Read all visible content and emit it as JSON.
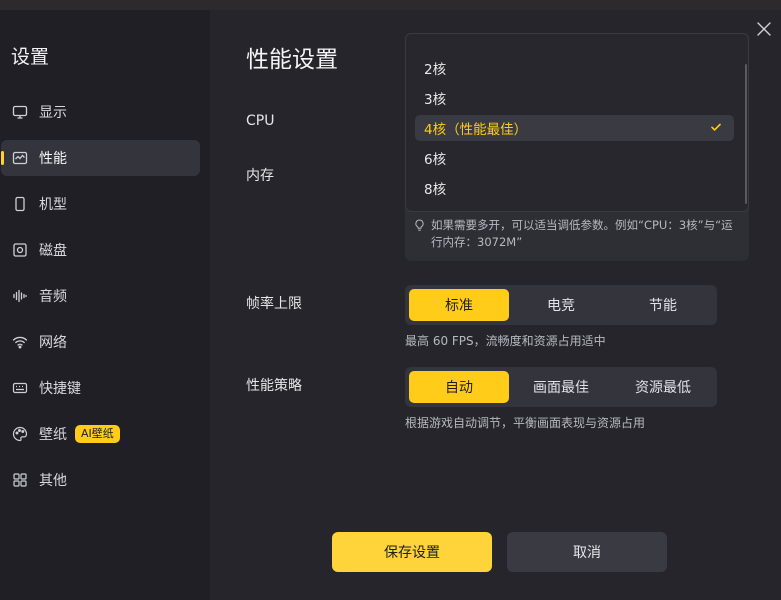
{
  "sidebar": {
    "title": "设置",
    "items": [
      {
        "label": "显示",
        "icon": "monitor-icon"
      },
      {
        "label": "性能",
        "icon": "performance-icon",
        "active": true
      },
      {
        "label": "机型",
        "icon": "phone-icon"
      },
      {
        "label": "磁盘",
        "icon": "disk-icon"
      },
      {
        "label": "音频",
        "icon": "audio-icon"
      },
      {
        "label": "网络",
        "icon": "wifi-icon"
      },
      {
        "label": "快捷键",
        "icon": "keyboard-icon"
      },
      {
        "label": "壁纸",
        "icon": "palette-icon",
        "badge": "AI壁纸"
      },
      {
        "label": "其他",
        "icon": "grid-icon"
      }
    ]
  },
  "page": {
    "title": "性能设置"
  },
  "cpu": {
    "label": "CPU",
    "options": [
      "2核",
      "3核",
      "4核（性能最佳）",
      "6核",
      "8核"
    ],
    "selected": "4核（性能最佳）"
  },
  "memory": {
    "label": "内存"
  },
  "hint": {
    "text": "如果需要多开，可以适当调低参数。例如“CPU：3核”与“运行内存：3072M”"
  },
  "framerate": {
    "label": "帧率上限",
    "options": [
      "标准",
      "电竞",
      "节能"
    ],
    "selected": "标准",
    "description": "最高 60 FPS，流畅度和资源占用适中"
  },
  "strategy": {
    "label": "性能策略",
    "options": [
      "自动",
      "画面最佳",
      "资源最低"
    ],
    "selected": "自动",
    "description": "根据游戏自动调节，平衡画面表现与资源占用"
  },
  "actions": {
    "save": "保存设置",
    "cancel": "取消"
  },
  "colors": {
    "accent": "#ffcc1a",
    "background": "#25252b",
    "sidebar": "#1f1f25"
  }
}
